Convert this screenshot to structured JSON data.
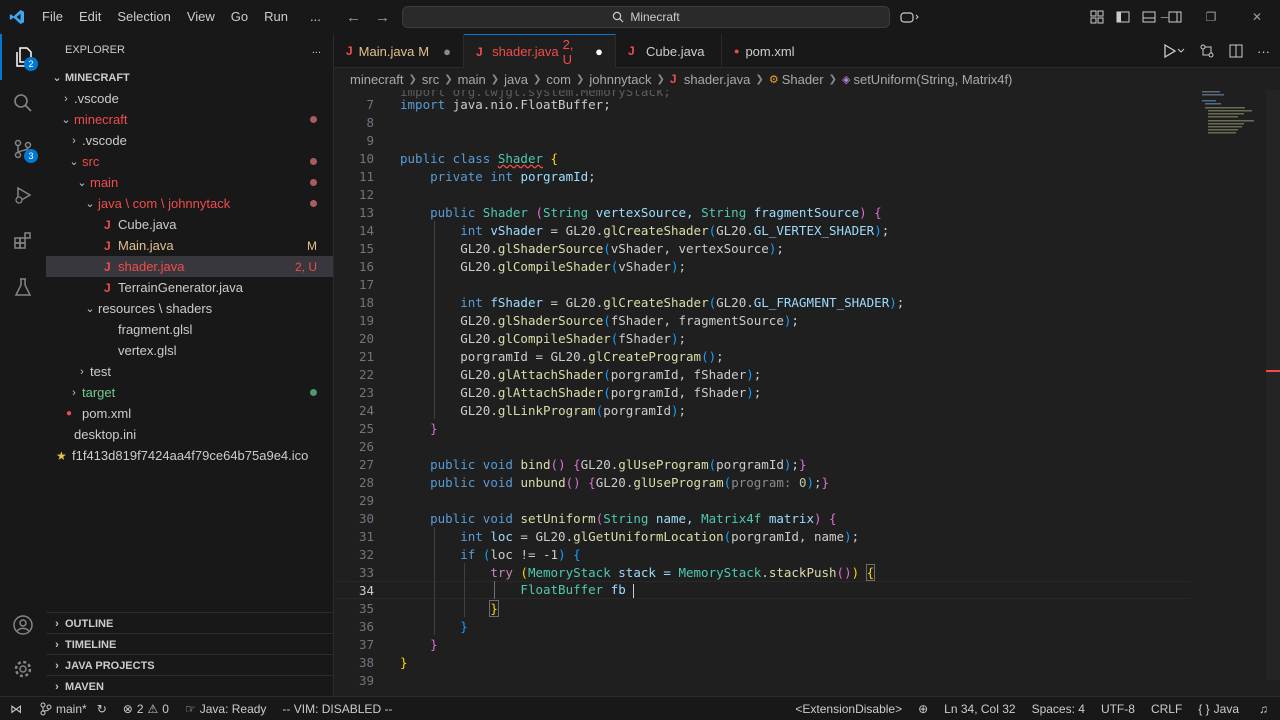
{
  "titlebar": {
    "menu": [
      "File",
      "Edit",
      "Selection",
      "View",
      "Go",
      "Run",
      "..."
    ],
    "search": "Minecraft"
  },
  "activity": {
    "explorer_badge": "2",
    "scm_badge": "3"
  },
  "explorer": {
    "title": "EXPLORER",
    "more": "...",
    "root": "MINECRAFT",
    "rows": [
      {
        "label": ".vscode",
        "deco": ""
      },
      {
        "label": "minecraft",
        "deco": ""
      },
      {
        "label": ".vscode",
        "deco": ""
      },
      {
        "label": "src",
        "deco": ""
      },
      {
        "label": "main",
        "deco": ""
      },
      {
        "label": "java \\ com \\ johnnytack",
        "deco": ""
      },
      {
        "label": "Cube.java",
        "deco": ""
      },
      {
        "label": "Main.java",
        "deco": "M"
      },
      {
        "label": "shader.java",
        "deco": "2, U"
      },
      {
        "label": "TerrainGenerator.java",
        "deco": ""
      },
      {
        "label": "resources \\ shaders",
        "deco": ""
      },
      {
        "label": "fragment.glsl",
        "deco": ""
      },
      {
        "label": "vertex.glsl",
        "deco": ""
      },
      {
        "label": "test",
        "deco": ""
      },
      {
        "label": "target",
        "deco": ""
      },
      {
        "label": "pom.xml",
        "deco": ""
      },
      {
        "label": "desktop.ini",
        "deco": ""
      },
      {
        "label": "f1f413d819f7424aa4f79ce64b75a9e4.ico",
        "deco": ""
      }
    ],
    "sections": [
      "OUTLINE",
      "TIMELINE",
      "JAVA PROJECTS",
      "MAVEN"
    ]
  },
  "tabs": [
    {
      "label": "Main.java",
      "status": "M"
    },
    {
      "label": "shader.java",
      "status": "2, U"
    },
    {
      "label": "Cube.java",
      "status": ""
    },
    {
      "label": "pom.xml",
      "status": ""
    }
  ],
  "breadcrumb": [
    "minecraft",
    "src",
    "main",
    "java",
    "com",
    "johnnytack",
    "shader.java",
    "Shader",
    "setUniform(String, Matrix4f)"
  ],
  "editor": {
    "line_numbers": [
      "7",
      "8",
      "9",
      "10",
      "11",
      "12",
      "13",
      "14",
      "15",
      "16",
      "17",
      "18",
      "19",
      "20",
      "21",
      "22",
      "23",
      "24",
      "25",
      "26",
      "27",
      "28",
      "29",
      "30",
      "31",
      "32",
      "33",
      "34",
      "35",
      "36",
      "37",
      "38",
      "39"
    ],
    "top_partial": "import org.lwjgl.system.MemoryStack;",
    "l7": [
      "import",
      "java.nio.FloatBuffer;"
    ],
    "l10": [
      "public class",
      "Shader",
      "{"
    ],
    "l11": [
      "private int",
      "porgramId",
      ";"
    ],
    "l13": [
      "public",
      "Shader",
      " (",
      "String",
      " vertexSource, ",
      "String",
      " fragmentSource",
      ") ",
      "{"
    ],
    "l14": [
      "int",
      "vShader",
      " = ",
      "GL20",
      ".",
      "glCreateShader",
      "(",
      "GL20",
      ".",
      "GL_VERTEX_SHADER",
      ")",
      ";"
    ],
    "l15": [
      "GL20",
      ".",
      "glShaderSource",
      "(",
      "vShader",
      ", ",
      "vertexSource",
      ")",
      ";"
    ],
    "l16": [
      "GL20",
      ".",
      "glCompileShader",
      "(",
      "vShader",
      ")",
      ";"
    ],
    "l18": [
      "int",
      "fShader",
      " = ",
      "GL20",
      ".",
      "glCreateShader",
      "(",
      "GL20",
      ".",
      "GL_FRAGMENT_SHADER",
      ")",
      ";"
    ],
    "l19": [
      "GL20",
      ".",
      "glShaderSource",
      "(",
      "fShader",
      ", ",
      "fragmentSource",
      ")",
      ";"
    ],
    "l20": [
      "GL20",
      ".",
      "glCompileShader",
      "(",
      "fShader",
      ")",
      ";"
    ],
    "l21": [
      "porgramId",
      " = ",
      "GL20",
      ".",
      "glCreateProgram",
      "()",
      ";"
    ],
    "l22": [
      "GL20",
      ".",
      "glAttachShader",
      "(",
      "porgramId",
      ", ",
      "fShader",
      ")",
      ";"
    ],
    "l23": [
      "GL20",
      ".",
      "glAttachShader",
      "(",
      "porgramId",
      ", ",
      "fShader",
      ")",
      ";"
    ],
    "l24": [
      "GL20",
      ".",
      "glLinkProgram",
      "(",
      "porgramId",
      ")",
      ";"
    ],
    "l25": [
      "}"
    ],
    "l27": [
      "public void",
      "bind",
      "() ",
      "{",
      "GL20",
      ".",
      "glUseProgram",
      "(",
      "porgramId",
      ")",
      ";",
      "}"
    ],
    "l28": [
      "public void",
      "unbund",
      "() ",
      "{",
      "GL20",
      ".",
      "glUseProgram",
      "(",
      "program:",
      " ",
      "0",
      ")",
      ";",
      "}"
    ],
    "l30": [
      "public void",
      "setUniform",
      "(",
      "String",
      " name, ",
      "Matrix4f",
      " matrix",
      ") ",
      "{"
    ],
    "l31": [
      "int",
      "loc",
      " = ",
      "GL20",
      ".",
      "glGetUniformLocation",
      "(",
      "porgramId",
      ", ",
      "name",
      ")",
      ";"
    ],
    "l32": [
      "if",
      " ",
      "(",
      "loc != -1",
      ") ",
      "{"
    ],
    "l33": [
      "try",
      " ",
      "(",
      "MemoryStack",
      " stack = ",
      "MemoryStack",
      ".",
      "stackPush",
      "()",
      ") ",
      "{"
    ],
    "l34": [
      "FloatBuffer",
      " fb "
    ],
    "l35": [
      "}"
    ],
    "l36": [
      "}"
    ],
    "l37": [
      "}"
    ],
    "l38": [
      "}"
    ]
  },
  "status": {
    "branch": "main*",
    "errors": "2",
    "warnings": "0",
    "java": "Java: Ready",
    "vim": "-- VIM: DISABLED --",
    "ext": "<ExtensionDisable>",
    "position": "Ln 34, Col 32",
    "spaces": "Spaces: 4",
    "encoding": "UTF-8",
    "eol": "CRLF",
    "lang": "Java"
  },
  "colors": {
    "accent": "#0078d4",
    "modified": "#e2c08d",
    "untracked": "#73c991",
    "error": "#f14c4c"
  }
}
